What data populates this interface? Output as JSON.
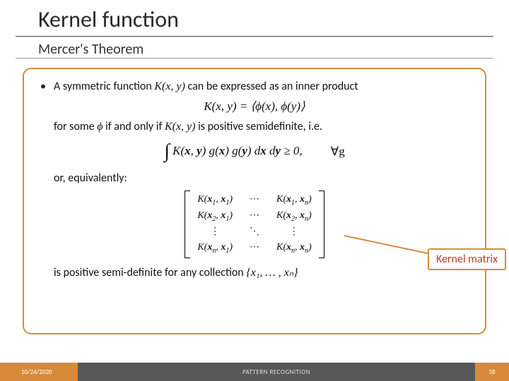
{
  "title": "Kernel function",
  "subtitle": "Mercer's Theorem",
  "body": {
    "intro_pre": "A symmetric function ",
    "intro_Kxy": "K(x, y)",
    "intro_post": " can be expressed as an inner product",
    "eq_inner": "K(x, y) = ⟨ϕ(x), ϕ(y)⟩",
    "cond_pre": "for some ",
    "cond_phi": "ϕ",
    "cond_mid": " if and only if ",
    "cond_Kxy": "K(x, y)",
    "cond_post": " is positive semidefinite, i.e.",
    "integral": "∫ K(x, y) g(x) g(y) dx dy ≥ 0,",
    "forall": "∀g",
    "equiv": "or, equivalently:",
    "matrix": {
      "r0c0": "K(x₁, x₁)",
      "r0c2": "K(x₁, xₙ)",
      "r1c0": "K(x₂, x₁)",
      "r1c2": "K(x₂, xₙ)",
      "r3c0": "K(xₙ, x₁)",
      "r3c2": "K(xₙ, xₙ)",
      "cdots": "⋯",
      "vdots": "⋮",
      "ddots": "⋱"
    },
    "closing_pre": "is positive semi-definite for any collection ",
    "closing_set": "{x₁, … , xₙ}"
  },
  "callout": "Kernel matrix",
  "footer": {
    "date": "10/24/2020",
    "course": "PATTERN RECOGNITION",
    "page": "58"
  }
}
